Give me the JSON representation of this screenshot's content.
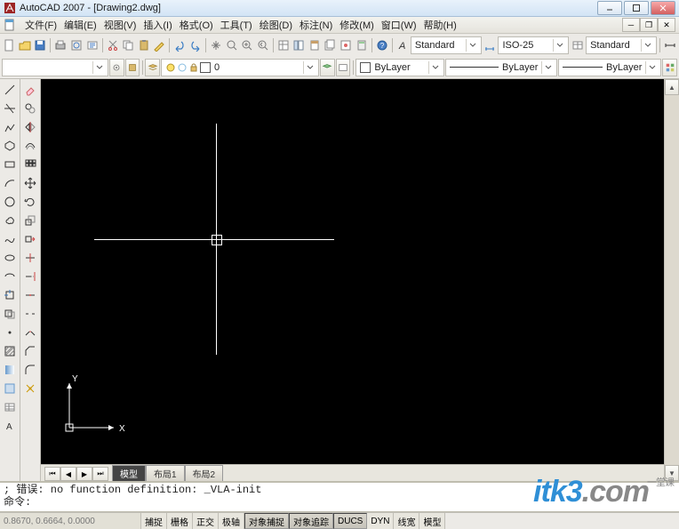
{
  "title": "AutoCAD 2007 - [Drawing2.dwg]",
  "menus": [
    "文件(F)",
    "编辑(E)",
    "视图(V)",
    "插入(I)",
    "格式(O)",
    "工具(T)",
    "绘图(D)",
    "标注(N)",
    "修改(M)",
    "窗口(W)",
    "帮助(H)"
  ],
  "styles": {
    "textStyle": "Standard",
    "dimStyle": "ISO-25",
    "tableStyle": "Standard"
  },
  "layer": {
    "current": "0",
    "color": "ByLayer",
    "linetype": "ByLayer",
    "lineweight": "ByLayer"
  },
  "tabs": {
    "items": [
      "模型",
      "布局1",
      "布局2"
    ],
    "active": 0
  },
  "cmd": {
    "line1": "; 错误: no function definition: _VLA-init",
    "prompt": "命令:"
  },
  "status": {
    "coords": "0.8670, 0.6664, 0.0000",
    "toggles": [
      {
        "label": "捕捉",
        "on": false
      },
      {
        "label": "栅格",
        "on": false
      },
      {
        "label": "正交",
        "on": false
      },
      {
        "label": "极轴",
        "on": false
      },
      {
        "label": "对象捕捉",
        "on": true
      },
      {
        "label": "对象追踪",
        "on": true
      },
      {
        "label": "DUCS",
        "on": true
      },
      {
        "label": "DYN",
        "on": false
      },
      {
        "label": "线宽",
        "on": false
      },
      {
        "label": "模型",
        "on": false
      }
    ]
  },
  "ucs": {
    "x": "X",
    "y": "Y"
  },
  "watermark": {
    "brand": "itk3",
    "tld": ".com",
    "cn": "一堂课"
  }
}
